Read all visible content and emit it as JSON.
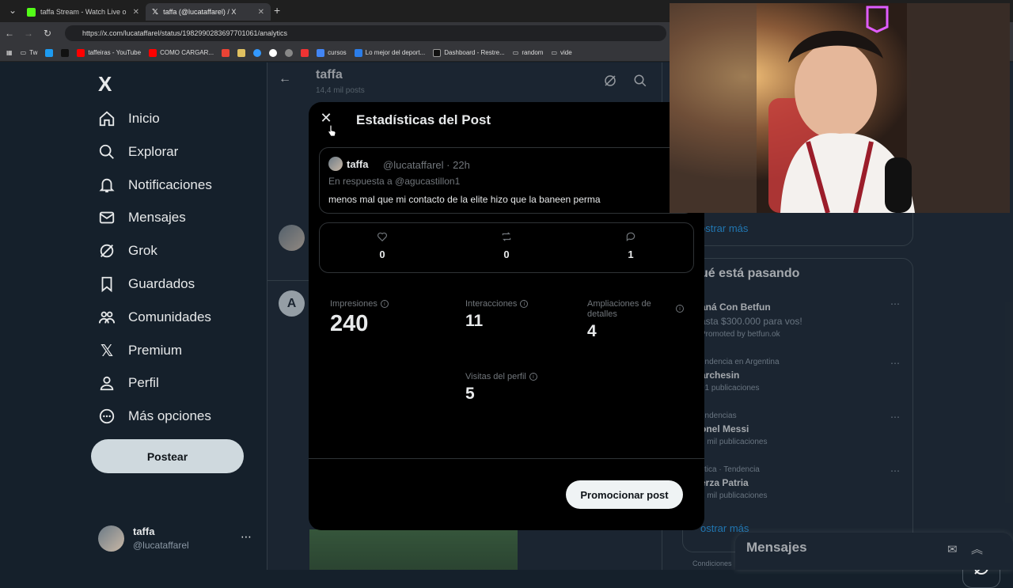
{
  "browser": {
    "tabs": [
      {
        "label": "taffa Stream - Watch Live o"
      },
      {
        "label": "taffa (@lucataffarel) / X"
      }
    ],
    "url": "https://x.com/lucataffarel/status/1982990283697701061/analytics",
    "bookmarks": [
      {
        "label": "Tw"
      },
      {
        "label": "taffeiras - YouTube"
      },
      {
        "label": "COMO CARGAR..."
      },
      {
        "label": "cursos"
      },
      {
        "label": "Lo mejor del deport..."
      },
      {
        "label": "Dashboard - Restre..."
      },
      {
        "label": "random"
      },
      {
        "label": "vide"
      }
    ]
  },
  "sidebar": {
    "logo": "X",
    "nav": [
      {
        "label": "Inicio",
        "icon": "home-icon"
      },
      {
        "label": "Explorar",
        "icon": "search-icon"
      },
      {
        "label": "Notificaciones",
        "icon": "bell-icon"
      },
      {
        "label": "Mensajes",
        "icon": "mail-icon"
      },
      {
        "label": "Grok",
        "icon": "grok-icon"
      },
      {
        "label": "Guardados",
        "icon": "bookmark-icon"
      },
      {
        "label": "Comunidades",
        "icon": "people-icon"
      },
      {
        "label": "Premium",
        "icon": "x-premium-icon"
      },
      {
        "label": "Perfil",
        "icon": "person-icon"
      },
      {
        "label": "Más opciones",
        "icon": "more-circle-icon"
      }
    ],
    "post_button": "Postear",
    "profile": {
      "name": "taffa",
      "handle": "@lucataffarel"
    }
  },
  "timeline": {
    "title": "taffa",
    "subtitle": "14,4 mil posts"
  },
  "right_panel": {
    "show_more_top": "ostrar más",
    "trends_title": "ué está pasando",
    "trends": [
      {
        "meta": "",
        "name": "aná Con Betfun",
        "count": "asta $300.000 para vos!",
        "promo": "Promoted by betfun.ok"
      },
      {
        "meta": "endencia en Argentina",
        "name": "archesin",
        "count": "01 publicaciones"
      },
      {
        "meta": "endencias",
        "name": "onel Messi",
        "count": "2 mil publicaciones"
      },
      {
        "meta": "lítica · Tendencia",
        "name": "erza Patria",
        "count": "2 mil publicaciones"
      }
    ],
    "show_more_bottom": "ostrar más",
    "footer": "Condiciones"
  },
  "messages_dock": {
    "title": "Mensajes"
  },
  "modal": {
    "title": "Estadísticas del Post",
    "quoted": {
      "name": "taffa",
      "handle": "@lucataffarel · 22h",
      "reply_to": "En respuesta a @agucastillon1",
      "text": "menos mal que mi contacto de la elite hizo que la baneen perma"
    },
    "engagement": {
      "likes": "0",
      "reposts": "0",
      "replies": "1"
    },
    "stats": {
      "impressions_label": "Impresiones",
      "impressions": "240",
      "interactions_label": "Interacciones",
      "interactions": "11",
      "detail_expands_label": "Ampliaciones de detalles",
      "detail_expands": "4",
      "profile_visits_label": "Visitas del perfil",
      "profile_visits": "5"
    },
    "promote_button": "Promocionar post"
  }
}
